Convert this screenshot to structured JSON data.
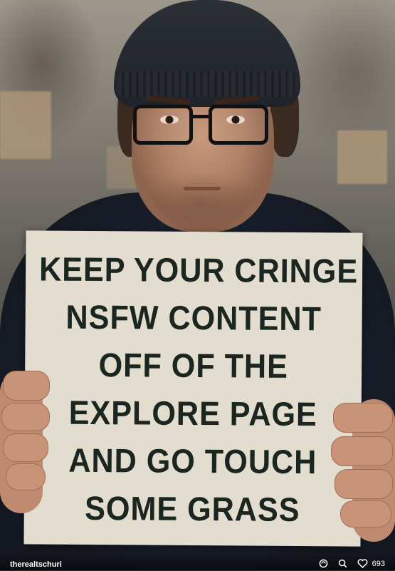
{
  "sign": {
    "lines": [
      "KEEP YOUR CRINGE",
      "NSFW CONTENT",
      "OFF OF THE",
      "EXPLORE PAGE",
      "AND GO TOUCH",
      "SOME GRASS"
    ]
  },
  "post": {
    "username": "therealtschuri",
    "like_count": "693"
  },
  "icons": {
    "remix": "remix-icon",
    "search": "search-icon",
    "like": "heart-icon"
  },
  "colors": {
    "sign_bg": "#e3ddd0",
    "sign_text": "#1b2620",
    "hoodie": "#1a2030"
  }
}
